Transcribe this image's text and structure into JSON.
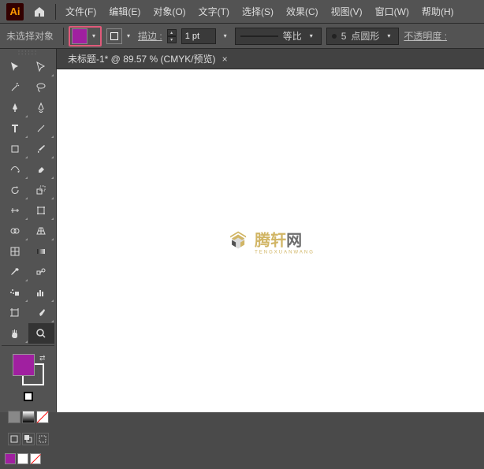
{
  "app": {
    "logo_text": "Ai"
  },
  "menu": {
    "file": "文件(F)",
    "edit": "编辑(E)",
    "object": "对象(O)",
    "type": "文字(T)",
    "select": "选择(S)",
    "effect": "效果(C)",
    "view": "视图(V)",
    "window": "窗口(W)",
    "help": "帮助(H)"
  },
  "ctrl": {
    "no_selection": "未选择对象",
    "stroke_label": "描边 :",
    "stroke_weight": "1 pt",
    "scale_label": "等比",
    "brush_size": "5",
    "brush_label": "点圆形",
    "opacity_label": "不透明度 :",
    "fill_color": "#a020a0"
  },
  "tab": {
    "title": "未标题-1* @ 89.57 % (CMYK/预览)"
  },
  "watermark": {
    "brand_a": "腾轩",
    "brand_b": "网",
    "sub": "TENGXUANWANG"
  },
  "tools": {
    "selection": "selection",
    "direct": "direct-selection",
    "wand": "magic-wand",
    "lasso": "lasso",
    "pen": "pen",
    "curve": "curvature",
    "type": "type",
    "line": "line",
    "rect": "rectangle",
    "brush": "paintbrush",
    "shaper": "shaper",
    "eraser": "eraser",
    "rotate": "rotate",
    "scale": "scale",
    "width": "width",
    "warp": "free-transform",
    "shape-builder": "shape-builder",
    "perspective": "perspective",
    "mesh": "mesh",
    "gradient": "gradient",
    "eyedropper": "eyedropper",
    "blend": "blend",
    "symbol": "symbol-sprayer",
    "graph": "column-graph",
    "artboard": "artboard",
    "slice": "slice",
    "hand": "hand",
    "zoom": "zoom"
  }
}
